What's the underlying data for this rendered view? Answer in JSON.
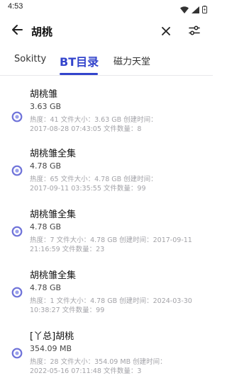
{
  "status": {
    "time": "4:53"
  },
  "search": {
    "query": "胡桃"
  },
  "tabs": [
    {
      "label": "Sokitty"
    },
    {
      "label": "BT目录"
    },
    {
      "label": "磁力天堂"
    }
  ],
  "results": [
    {
      "title": "胡桃雏",
      "size": "3.63 GB",
      "meta1": "热度：41  文件大小：3.63 GB  创建时间：",
      "meta2": "2017-08-28 07:43:05  文件数量：8"
    },
    {
      "title": "胡桃雏全集",
      "size": "4.78 GB",
      "meta1": "热度：65  文件大小：4.78 GB  创建时间：",
      "meta2": "2017-09-11 03:35:55  文件数量：99"
    },
    {
      "title": "胡桃雏全集",
      "size": "4.78 GB",
      "meta1": "热度：7  文件大小：4.78 GB  创建时间：2017-09-11",
      "meta2": "21:16:59  文件数量：23"
    },
    {
      "title": "胡桃雏全集",
      "size": "4.78 GB",
      "meta1": "热度：1  文件大小：4.78 GB  创建时间：2024-03-30",
      "meta2": "10:38:27  文件数量：99"
    },
    {
      "title": "[丫总]胡桃",
      "size": "354.09 MB",
      "meta1": "热度：28  文件大小：354.09 MB  创建时间：",
      "meta2": "2022-05-16 07:11:48  文件数量：3"
    }
  ],
  "colors": {
    "accent": "#3344cc",
    "icon_ring": "#6f73d9",
    "meta_text": "#a3a3a8"
  }
}
